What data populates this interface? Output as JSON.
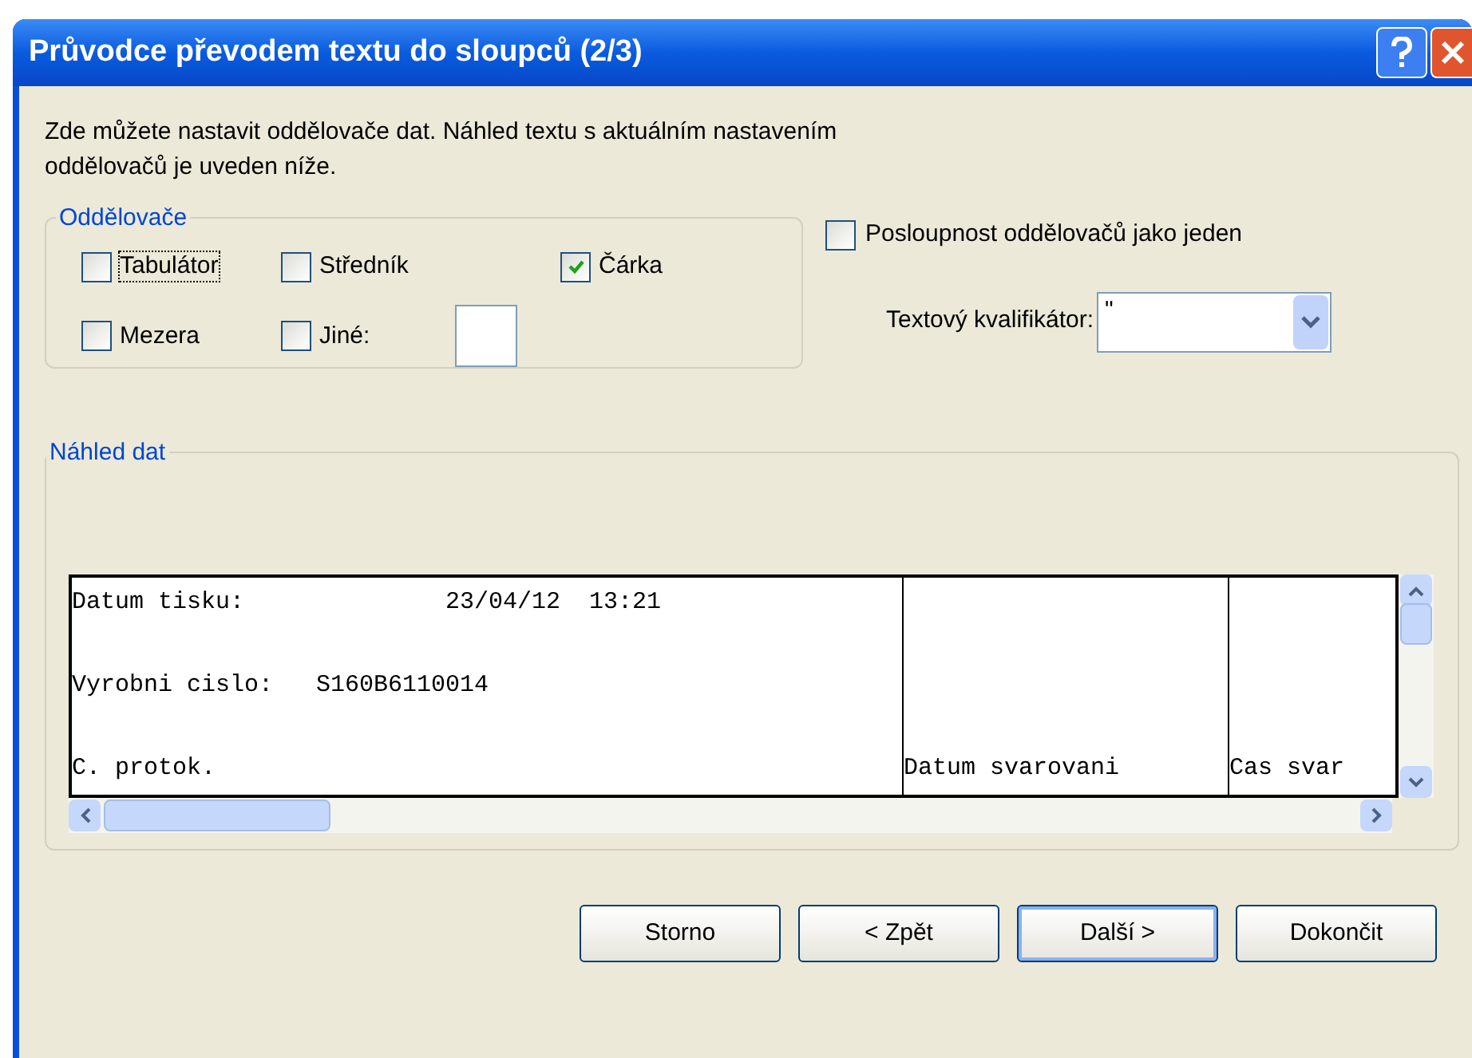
{
  "window": {
    "title": "Průvodce převodem textu do sloupců (2/3)"
  },
  "description": "Zde můžete nastavit oddělovače dat. Náhled textu s aktuálním nastavením oddělovačů je uveden níže.",
  "delimiters": {
    "title": "Oddělovače",
    "options": [
      {
        "label": "Tabulátor",
        "checked": false,
        "focused": true
      },
      {
        "label": "Středník",
        "checked": false,
        "focused": false
      },
      {
        "label": "Čárka",
        "checked": true,
        "focused": false
      },
      {
        "label": "Mezera",
        "checked": false,
        "focused": false
      },
      {
        "label": "Jiné:",
        "checked": false,
        "focused": false
      }
    ]
  },
  "consecutive": {
    "label": "Posloupnost oddělovačů jako jeden",
    "checked": false
  },
  "qualifier": {
    "label": "Textový kvalifikátor:",
    "value": "\""
  },
  "preview": {
    "title": "Náhled dat",
    "rows": [
      {
        "cells": [
          "Datum tisku:              23/04/12  13:21"
        ]
      },
      {
        "cells": [
          "Vyrobni cislo:   S160B6110014"
        ]
      },
      {
        "cells": [
          "C. protok.",
          "Datum svarovani",
          "Cas svar"
        ]
      }
    ]
  },
  "buttons": [
    {
      "label": "Storno",
      "default": false
    },
    {
      "label": "< Zpět",
      "default": false
    },
    {
      "label": "Další >",
      "default": true
    },
    {
      "label": "Dokončit",
      "default": false
    }
  ]
}
